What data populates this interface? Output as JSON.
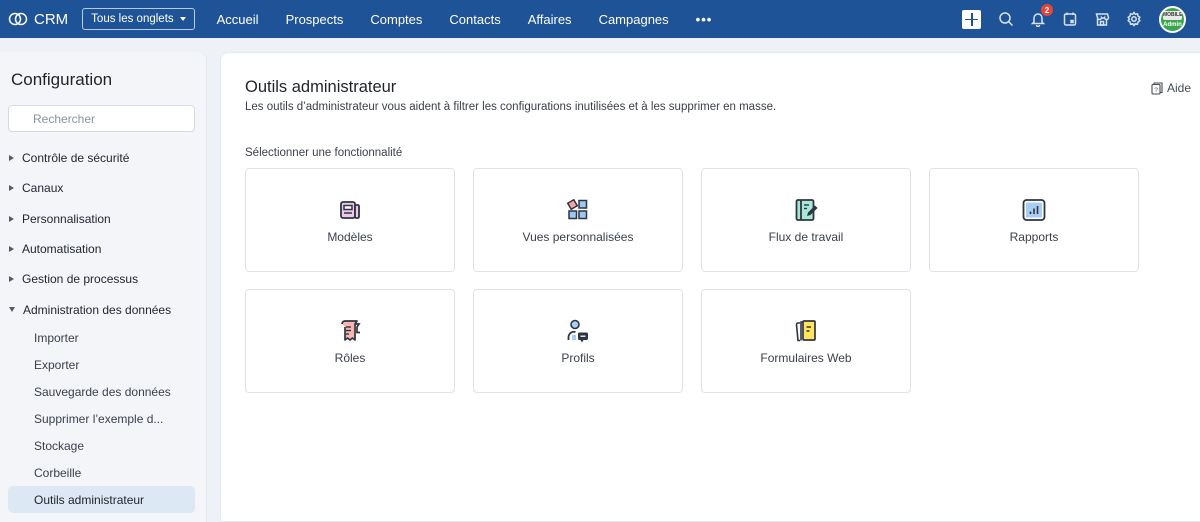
{
  "topbar": {
    "app_name": "CRM",
    "tabs_dropdown": "Tous les onglets",
    "nav": [
      "Accueil",
      "Prospects",
      "Comptes",
      "Contacts",
      "Affaires",
      "Campagnes"
    ],
    "more": "•••",
    "notification_count": "2",
    "avatar_text": "Admin",
    "avatar_top": "MOBILE",
    "brand_color": "#1f5397"
  },
  "sidebar": {
    "title": "Configuration",
    "search_placeholder": "Rechercher",
    "sections": [
      {
        "label": "Contrôle de sécurité",
        "expanded": false
      },
      {
        "label": "Canaux",
        "expanded": false
      },
      {
        "label": "Personnalisation",
        "expanded": false
      },
      {
        "label": "Automatisation",
        "expanded": false
      },
      {
        "label": "Gestion de processus",
        "expanded": false
      },
      {
        "label": "Administration des données",
        "expanded": true
      }
    ],
    "sub_items": [
      {
        "label": "Importer"
      },
      {
        "label": "Exporter"
      },
      {
        "label": "Sauvegarde des données"
      },
      {
        "label": "Supprimer l’exemple d..."
      },
      {
        "label": "Stockage"
      },
      {
        "label": "Corbeille"
      },
      {
        "label": "Outils administrateur",
        "active": true
      }
    ]
  },
  "main": {
    "title": "Outils administrateur",
    "description": "Les outils d’administrateur vous aident à filtrer les configurations inutilisées et à les supprimer en masse.",
    "help": "Aide",
    "select_label": "Sélectionner une fonctionnalité",
    "cards": [
      {
        "label": "Modèles",
        "icon": "template-icon"
      },
      {
        "label": "Vues personnalisées",
        "icon": "custom-views-icon"
      },
      {
        "label": "Flux de travail",
        "icon": "workflow-icon"
      },
      {
        "label": "Rapports",
        "icon": "reports-icon"
      },
      {
        "label": "Rôles",
        "icon": "roles-icon"
      },
      {
        "label": "Profils",
        "icon": "profiles-icon"
      },
      {
        "label": "Formulaires Web",
        "icon": "webforms-icon"
      }
    ]
  }
}
